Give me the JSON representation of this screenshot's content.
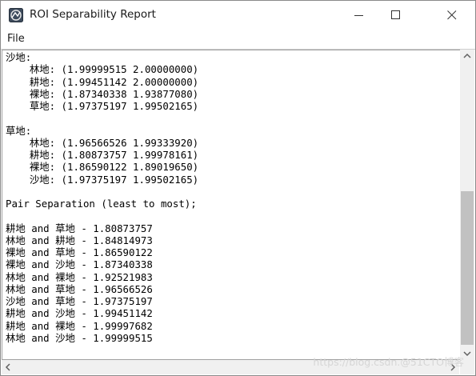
{
  "window": {
    "title": "ROI Separability Report"
  },
  "menu": {
    "file_label": "File"
  },
  "report_lines": [
    "沙地:",
    "    林地: (1.99999515 2.00000000)",
    "    耕地: (1.99451142 2.00000000)",
    "    裸地: (1.87340338 1.93877080)",
    "    草地: (1.97375197 1.99502165)",
    "",
    "草地:",
    "    林地: (1.96566526 1.99333920)",
    "    耕地: (1.80873757 1.99978161)",
    "    裸地: (1.86590122 1.89019650)",
    "    沙地: (1.97375197 1.99502165)",
    "",
    "Pair Separation (least to most);",
    "",
    "耕地 and 草地 - 1.80873757",
    "林地 and 耕地 - 1.84814973",
    "裸地 and 草地 - 1.86590122",
    "裸地 and 沙地 - 1.87340338",
    "林地 and 裸地 - 1.92521983",
    "林地 and 草地 - 1.96566526",
    "沙地 and 草地 - 1.97375197",
    "耕地 and 沙地 - 1.99451142",
    "耕地 and 裸地 - 1.99997682",
    "林地 and 沙地 - 1.99999515"
  ],
  "watermark": "https://blog.csdn.@51CTO博客",
  "icons": {
    "app": "envi-app-icon",
    "minimize": "minimize-icon",
    "maximize": "maximize-icon",
    "close": "close-icon",
    "scroll_up": "arrow-up-icon",
    "scroll_down": "arrow-down-icon",
    "scroll_left": "arrow-left-icon",
    "scroll_right": "arrow-right-icon"
  }
}
